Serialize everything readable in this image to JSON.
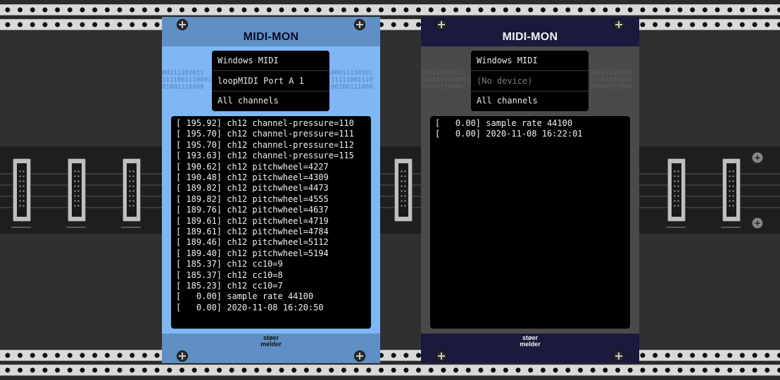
{
  "modules": [
    {
      "title": "MIDI-MON",
      "driver": "Windows MIDI",
      "device": "loopMIDI Port A 1",
      "channel": "All channels",
      "binary_left": "00111101011\n1111001110001\n01001110000",
      "binary_right": "00011110101\n11111001110\n00100111000",
      "log": [
        "[ 195.92] ch12 channel-pressure=110",
        "[ 195.70] ch12 channel-pressure=111",
        "[ 195.70] ch12 channel-pressure=112",
        "[ 193.63] ch12 channel-pressure=115",
        "[ 190.62] ch12 pitchwheel=4227",
        "[ 190.48] ch12 pitchwheel=4309",
        "[ 189.82] ch12 pitchwheel=4473",
        "[ 189.82] ch12 pitchwheel=4555",
        "[ 189.76] ch12 pitchwheel=4637",
        "[ 189.61] ch12 pitchwheel=4719",
        "[ 189.61] ch12 pitchwheel=4784",
        "[ 189.46] ch12 pitchwheel=5112",
        "[ 189.40] ch12 pitchwheel=5194",
        "[ 185.37] ch12 cc10=9",
        "[ 185.37] ch12 cc10=8",
        "[ 185.23] ch12 cc10=7",
        "[   0.00] sample rate 44100",
        "[   0.00] 2020-11-08 16:20:50"
      ],
      "brand_top": "støer",
      "brand_bottom": "melder",
      "colors": {
        "panel": "#7fb6f5",
        "header": "#5f8fc4",
        "title": "#0b0b2a"
      }
    },
    {
      "title": "MIDI-MON",
      "driver": "Windows MIDI",
      "device": "(No device)",
      "channel": "All channels",
      "binary_left": "00111101011\n1111001110001\n01001110000",
      "binary_right": "00011110101\n11111001110\n00100111000",
      "log": [
        "[   0.00] sample rate 44100",
        "[   0.00] 2020-11-08 16:22:01"
      ],
      "brand_top": "støer",
      "brand_bottom": "melder",
      "colors": {
        "panel": "#4a4a4a",
        "header": "#191a3c",
        "title": "#f2f2f2"
      }
    }
  ]
}
